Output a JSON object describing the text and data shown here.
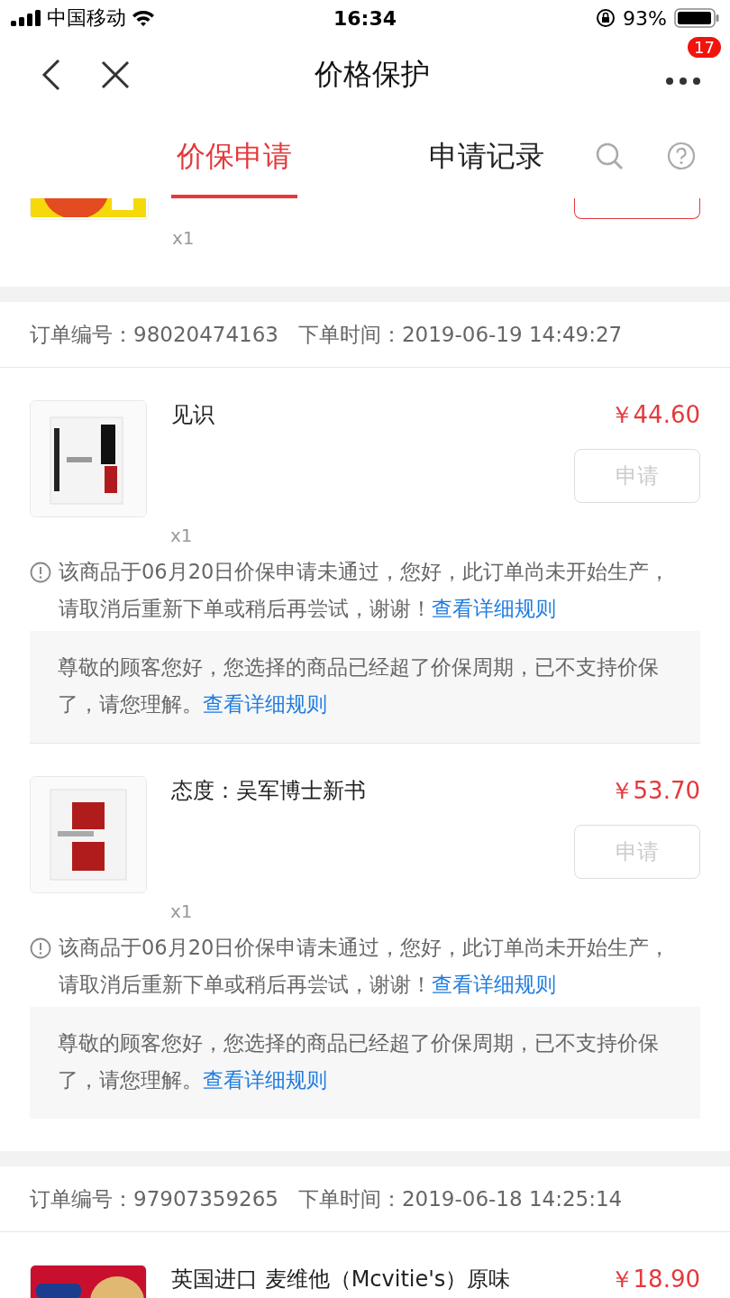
{
  "status_bar": {
    "carrier": "中国移动",
    "time": "16:34",
    "battery": "93%"
  },
  "nav": {
    "title": "价格保护",
    "badge": "17"
  },
  "tabs": [
    {
      "label": "价保申请",
      "selected": true
    },
    {
      "label": "申请记录",
      "selected": false
    }
  ],
  "partial_item": {
    "quantity": "x1",
    "button": {
      "disabled": false
    }
  },
  "orders": [
    {
      "order_label": "订单编号：",
      "order_no": "98020474163",
      "time_label": "下单时间：",
      "time": "2019-06-19 14:49:27",
      "items": [
        {
          "name": "见识",
          "price": "￥44.60",
          "quantity": "x1",
          "button": {
            "label": "申请",
            "disabled": true
          },
          "notice": {
            "text": "该商品于06月20日价保申请未通过，您好，此订单尚未开始生产，请取消后重新下单或稍后再尝试，谢谢！",
            "link": "查看详细规则"
          },
          "info": {
            "text": "尊敬的顾客您好，您选择的商品已经超了价保周期，已不支持价保了，请您理解。",
            "link": "查看详细规则"
          }
        },
        {
          "name": "态度：吴军博士新书",
          "price": "￥53.70",
          "quantity": "x1",
          "button": {
            "label": "申请",
            "disabled": true
          },
          "notice": {
            "text": "该商品于06月20日价保申请未通过，您好，此订单尚未开始生产，请取消后重新下单或稍后再尝试，谢谢！",
            "link": "查看详细规则"
          },
          "info": {
            "text": "尊敬的顾客您好，您选择的商品已经超了价保周期，已不支持价保了，请您理解。",
            "link": "查看详细规则"
          }
        }
      ]
    },
    {
      "order_label": "订单编号：",
      "order_no": "97907359265",
      "time_label": "下单时间：",
      "time": "2019-06-18 14:25:14",
      "items": [
        {
          "name": "英国进口 麦维他（Mcvitie's）原味",
          "price": "￥18.90"
        }
      ]
    }
  ]
}
